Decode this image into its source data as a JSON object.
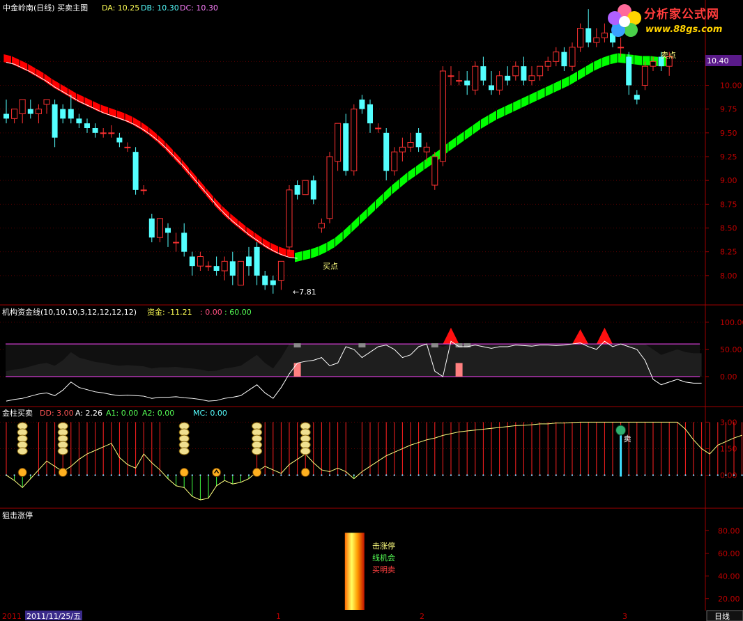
{
  "main": {
    "title": "中金岭南(日线) 买卖主图",
    "da": "DA: 10.25",
    "db": "DB: 10.30",
    "dc": "DC: 10.30",
    "buy_label": "买点",
    "sell_label": "卖点",
    "low_label": "←7.81",
    "price_tag": "10.40"
  },
  "logo": {
    "title": "分析家公式网",
    "url": "www.88gs.com"
  },
  "panel2": {
    "title": "机构资金线(10,10,10,3,12,12,12,12)",
    "zijin": "资金: -11.21",
    "v1": ": 0.00",
    "v2": ": 60.00"
  },
  "panel3": {
    "title": "金柱买卖",
    "dd": "DD: 3.00",
    "a": "A: 2.26",
    "a1": "A1: 0.00",
    "a2": "A2: 0.00",
    "mc": "MC: 0.00",
    "sell_mark": "卖"
  },
  "panel4": {
    "title": "狙击涨停",
    "line1": "击涨停",
    "line2": "线机会",
    "line3": "买明卖"
  },
  "footer": {
    "year": "2011",
    "date": "2011/11/25/五",
    "m1": "1",
    "m2": "2",
    "m3": "3",
    "period": "日线"
  },
  "colors": {
    "up": "#ff3232",
    "down": "#54ffff",
    "band_down": "#ff0000",
    "band_up": "#00ff00",
    "axis": "#a00000",
    "ref_line": "#e040e0",
    "white_line": "#ffffff",
    "yellow_line": "#ffff80"
  },
  "chart_data": [
    {
      "type": "candlestick",
      "title": "中金岭南(日线) 买卖主图",
      "ylim": [
        7.75,
        10.75
      ],
      "yticks": [
        8.0,
        8.25,
        8.5,
        8.75,
        9.0,
        9.25,
        9.5,
        9.75,
        10.0,
        10.25
      ],
      "annotations": [
        "买点",
        "卖点",
        "←7.81",
        "10.40"
      ],
      "candles": [
        [
          9.7,
          9.85,
          9.65,
          9.6
        ],
        [
          9.65,
          9.7,
          9.75,
          9.6
        ],
        [
          9.7,
          9.75,
          9.85,
          9.6
        ],
        [
          9.75,
          9.85,
          9.7,
          9.65
        ],
        [
          9.7,
          9.8,
          9.75,
          9.6
        ],
        [
          9.8,
          9.82,
          9.85,
          9.7
        ],
        [
          9.8,
          9.85,
          9.45,
          9.35
        ],
        [
          9.75,
          9.8,
          9.65,
          9.6
        ],
        [
          9.75,
          9.9,
          9.65,
          9.6
        ],
        [
          9.65,
          9.7,
          9.6,
          9.55
        ],
        [
          9.6,
          9.65,
          9.55,
          9.5
        ],
        [
          9.55,
          9.6,
          9.5,
          9.45
        ],
        [
          9.5,
          9.55,
          9.5,
          9.45
        ],
        [
          9.5,
          9.58,
          9.5,
          9.45
        ],
        [
          9.45,
          9.5,
          9.4,
          9.35
        ],
        [
          9.35,
          9.4,
          9.35,
          9.3
        ],
        [
          9.3,
          9.35,
          8.9,
          8.85
        ],
        [
          8.9,
          8.95,
          8.9,
          8.85
        ],
        [
          8.6,
          8.65,
          8.4,
          8.35
        ],
        [
          8.4,
          8.6,
          8.6,
          8.35
        ],
        [
          8.5,
          8.55,
          8.45,
          8.3
        ],
        [
          8.35,
          8.45,
          8.35,
          8.25
        ],
        [
          8.45,
          8.55,
          8.25,
          8.2
        ],
        [
          8.2,
          8.25,
          8.1,
          8.0
        ],
        [
          8.1,
          8.25,
          8.2,
          8.05
        ],
        [
          8.1,
          8.15,
          8.1,
          8.05
        ],
        [
          8.1,
          8.2,
          8.05,
          8.0
        ],
        [
          8.05,
          8.2,
          8.15,
          7.95
        ],
        [
          8.15,
          8.25,
          8.0,
          7.9
        ],
        [
          7.9,
          8.15,
          8.15,
          7.9
        ],
        [
          8.2,
          8.3,
          8.1,
          8.0
        ],
        [
          8.3,
          8.35,
          8.0,
          7.9
        ],
        [
          8.0,
          8.05,
          7.9,
          7.85
        ],
        [
          7.95,
          8.0,
          7.9,
          7.81
        ],
        [
          7.95,
          8.15,
          8.15,
          7.85
        ],
        [
          8.3,
          8.95,
          8.9,
          8.25
        ],
        [
          8.95,
          9.0,
          8.85,
          8.8
        ],
        [
          8.85,
          9.0,
          9.0,
          8.85
        ],
        [
          9.0,
          9.05,
          8.8,
          8.75
        ],
        [
          8.5,
          8.6,
          8.55,
          8.45
        ],
        [
          8.6,
          9.3,
          9.25,
          8.55
        ],
        [
          9.2,
          9.6,
          9.6,
          9.1
        ],
        [
          9.6,
          9.7,
          9.1,
          9.05
        ],
        [
          9.1,
          9.8,
          9.75,
          9.05
        ],
        [
          9.85,
          9.9,
          9.75,
          9.7
        ],
        [
          9.8,
          9.85,
          9.6,
          9.5
        ],
        [
          9.55,
          9.6,
          9.55,
          9.5
        ],
        [
          9.5,
          9.55,
          9.1,
          9.0
        ],
        [
          9.1,
          9.35,
          9.3,
          9.05
        ],
        [
          9.3,
          9.45,
          9.35,
          9.2
        ],
        [
          9.35,
          9.5,
          9.4,
          9.3
        ],
        [
          9.5,
          9.55,
          9.35,
          9.3
        ],
        [
          9.3,
          9.4,
          9.35,
          9.2
        ],
        [
          8.95,
          9.3,
          9.25,
          8.9
        ],
        [
          9.2,
          10.2,
          10.15,
          9.15
        ],
        [
          10.1,
          10.2,
          10.1,
          10.0
        ],
        [
          10.05,
          10.15,
          10.05,
          10.0
        ],
        [
          10.05,
          10.15,
          10.0,
          9.9
        ],
        [
          9.95,
          10.25,
          10.2,
          9.9
        ],
        [
          10.2,
          10.3,
          10.05,
          10.0
        ],
        [
          10.0,
          10.15,
          9.95,
          9.9
        ],
        [
          9.95,
          10.15,
          10.1,
          9.9
        ],
        [
          10.1,
          10.2,
          10.05,
          10.0
        ],
        [
          10.1,
          10.25,
          10.2,
          10.05
        ],
        [
          10.2,
          10.3,
          10.05,
          10.0
        ],
        [
          10.05,
          10.2,
          10.1,
          10.0
        ],
        [
          10.1,
          10.2,
          10.2,
          10.05
        ],
        [
          10.2,
          10.3,
          10.25,
          10.15
        ],
        [
          10.25,
          10.4,
          10.35,
          10.2
        ],
        [
          10.35,
          10.4,
          10.2,
          10.15
        ],
        [
          10.2,
          10.45,
          10.4,
          10.15
        ],
        [
          10.4,
          10.65,
          10.6,
          10.35
        ],
        [
          10.6,
          10.8,
          10.45,
          10.4
        ],
        [
          10.45,
          10.6,
          10.5,
          10.4
        ],
        [
          10.5,
          10.65,
          10.55,
          10.45
        ],
        [
          10.55,
          10.75,
          10.45,
          10.4
        ],
        [
          10.4,
          10.5,
          10.4,
          10.3
        ],
        [
          10.3,
          10.35,
          10.0,
          9.9
        ],
        [
          9.9,
          9.95,
          9.85,
          9.8
        ],
        [
          10.0,
          10.25,
          10.2,
          9.95
        ],
        [
          10.2,
          10.3,
          10.25,
          10.15
        ],
        [
          10.3,
          10.35,
          10.2,
          10.15
        ],
        [
          10.2,
          10.35,
          10.3,
          10.1
        ]
      ],
      "band": [
        10.3,
        10.28,
        10.24,
        10.2,
        10.15,
        10.1,
        10.04,
        9.99,
        9.94,
        9.89,
        9.85,
        9.81,
        9.77,
        9.74,
        9.71,
        9.68,
        9.64,
        9.59,
        9.53,
        9.46,
        9.38,
        9.29,
        9.2,
        9.1,
        9.0,
        8.9,
        8.8,
        8.71,
        8.63,
        8.56,
        8.49,
        8.43,
        8.37,
        8.32,
        8.28,
        8.25,
        8.24,
        8.26,
        8.28,
        8.31,
        8.35,
        8.4,
        8.47,
        8.55,
        8.63,
        8.71,
        8.79,
        8.87,
        8.95,
        9.02,
        9.09,
        9.15,
        9.21,
        9.27,
        9.33,
        9.4,
        9.46,
        9.52,
        9.58,
        9.64,
        9.69,
        9.74,
        9.78,
        9.82,
        9.86,
        9.9,
        9.94,
        9.98,
        10.02,
        10.06,
        10.1,
        10.15,
        10.2,
        10.25,
        10.29,
        10.32,
        10.34,
        10.33,
        10.32,
        10.31,
        10.31,
        10.3,
        10.3
      ],
      "band_turn_index": 36
    },
    {
      "type": "line",
      "title": "机构资金线(10,10,10,3,12,12,12,12)",
      "ylim": [
        -50,
        110
      ],
      "yticks": [
        100.0,
        50.0,
        0.0
      ],
      "ref_lines": [
        60,
        0
      ],
      "series": [
        {
          "name": "资金",
          "values": [
            -45,
            -42,
            -40,
            -36,
            -32,
            -30,
            -35,
            -25,
            -10,
            -20,
            -24,
            -28,
            -30,
            -33,
            -35,
            -34,
            -35,
            -36,
            -40,
            -38,
            -38,
            -37,
            -39,
            -40,
            -42,
            -45,
            -44,
            -40,
            -38,
            -35,
            -25,
            -15,
            -30,
            -40,
            -20,
            5,
            25,
            28,
            30,
            35,
            20,
            25,
            55,
            50,
            35,
            45,
            55,
            58,
            50,
            35,
            40,
            55,
            60,
            10,
            0,
            65,
            55,
            55,
            58,
            55,
            52,
            55,
            55,
            58,
            57,
            56,
            58,
            58,
            57,
            58,
            60,
            62,
            55,
            50,
            65,
            55,
            60,
            55,
            50,
            30,
            -5,
            -15,
            -10,
            -5,
            -10,
            -12,
            -12
          ]
        }
      ]
    },
    {
      "type": "line",
      "title": "金柱买卖",
      "ylim": [
        -1.75,
        3.25
      ],
      "yticks": [
        3.0,
        1.5,
        0.0
      ],
      "series": [
        {
          "name": "DD",
          "values": [
            0,
            -0.3,
            -0.7,
            -0.2,
            0.3,
            0.8,
            0.5,
            0.2,
            0.5,
            0.9,
            1.2,
            1.4,
            1.6,
            1.8,
            1.0,
            0.6,
            0.4,
            1.2,
            0.7,
            0.3,
            -0.2,
            -0.6,
            -0.7,
            -1.2,
            -1.4,
            -1.3,
            -0.6,
            -0.3,
            -0.5,
            -0.4,
            -0.2,
            0.2,
            0.5,
            0.3,
            0.1,
            0.6,
            0.9,
            1.2,
            0.7,
            0.3,
            0.2,
            0.4,
            0.2,
            -0.2,
            0.2,
            0.5,
            0.8,
            1.1,
            1.3,
            1.5,
            1.7,
            1.85,
            2.0,
            2.1,
            2.25,
            2.35,
            2.45,
            2.5,
            2.55,
            2.6,
            2.65,
            2.7,
            2.75,
            2.8,
            2.82,
            2.85,
            2.9,
            2.9,
            2.95,
            2.95,
            2.98,
            3.0,
            3.0,
            3.0,
            3.0,
            3.0,
            3.0,
            3.0,
            3.0,
            3.0,
            3.0,
            3.0,
            3.0,
            3.0,
            2.6,
            2.0,
            1.5,
            1.2,
            1.7,
            1.9,
            2.1,
            2.26
          ]
        }
      ],
      "signals": [
        {
          "type": "coin_stack",
          "index": 2
        },
        {
          "type": "coin_stack",
          "index": 7
        },
        {
          "type": "coin_stack",
          "index": 22
        },
        {
          "type": "up_arrow",
          "index": 26
        },
        {
          "type": "coin_stack",
          "index": 31
        },
        {
          "type": "coin_stack",
          "index": 37
        },
        {
          "type": "sell",
          "index": 76,
          "label": "卖"
        }
      ]
    },
    {
      "type": "bar",
      "title": "狙击涨停",
      "ylim": [
        10,
        90
      ],
      "yticks": [
        80.0,
        60.0,
        40.0,
        20.0
      ],
      "annotations": [
        "击涨停",
        "线机会",
        "买明卖"
      ],
      "bars": [
        {
          "index": 43,
          "value": 80,
          "style": "gradient"
        }
      ]
    }
  ]
}
